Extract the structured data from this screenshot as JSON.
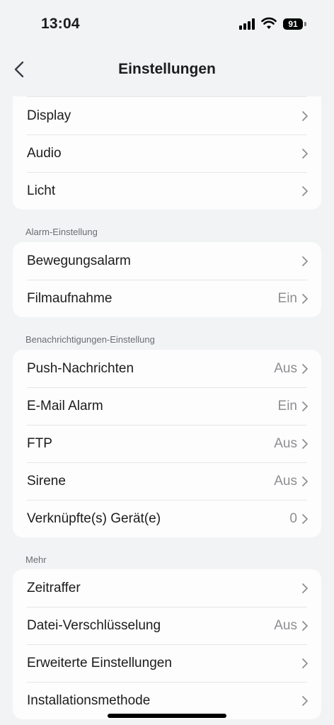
{
  "status_bar": {
    "time": "13:04",
    "battery": "91"
  },
  "nav": {
    "title": "Einstellungen"
  },
  "group_top": {
    "items": [
      {
        "label": "Display",
        "value": ""
      },
      {
        "label": "Audio",
        "value": ""
      },
      {
        "label": "Licht",
        "value": ""
      }
    ]
  },
  "group_alarm": {
    "header": "Alarm-Einstellung",
    "items": [
      {
        "label": "Bewegungsalarm",
        "value": ""
      },
      {
        "label": "Filmaufnahme",
        "value": "Ein"
      }
    ]
  },
  "group_notify": {
    "header": "Benachrichtigungen-Einstellung",
    "items": [
      {
        "label": "Push-Nachrichten",
        "value": "Aus"
      },
      {
        "label": "E-Mail Alarm",
        "value": "Ein"
      },
      {
        "label": "FTP",
        "value": "Aus"
      },
      {
        "label": "Sirene",
        "value": "Aus"
      },
      {
        "label": "Verknüpfte(s) Gerät(e)",
        "value": "0"
      }
    ]
  },
  "group_more": {
    "header": "Mehr",
    "items": [
      {
        "label": "Zeitraffer",
        "value": ""
      },
      {
        "label": "Datei-Verschlüsselung",
        "value": "Aus"
      },
      {
        "label": "Erweiterte Einstellungen",
        "value": ""
      },
      {
        "label": "Installationsmethode",
        "value": ""
      }
    ]
  }
}
